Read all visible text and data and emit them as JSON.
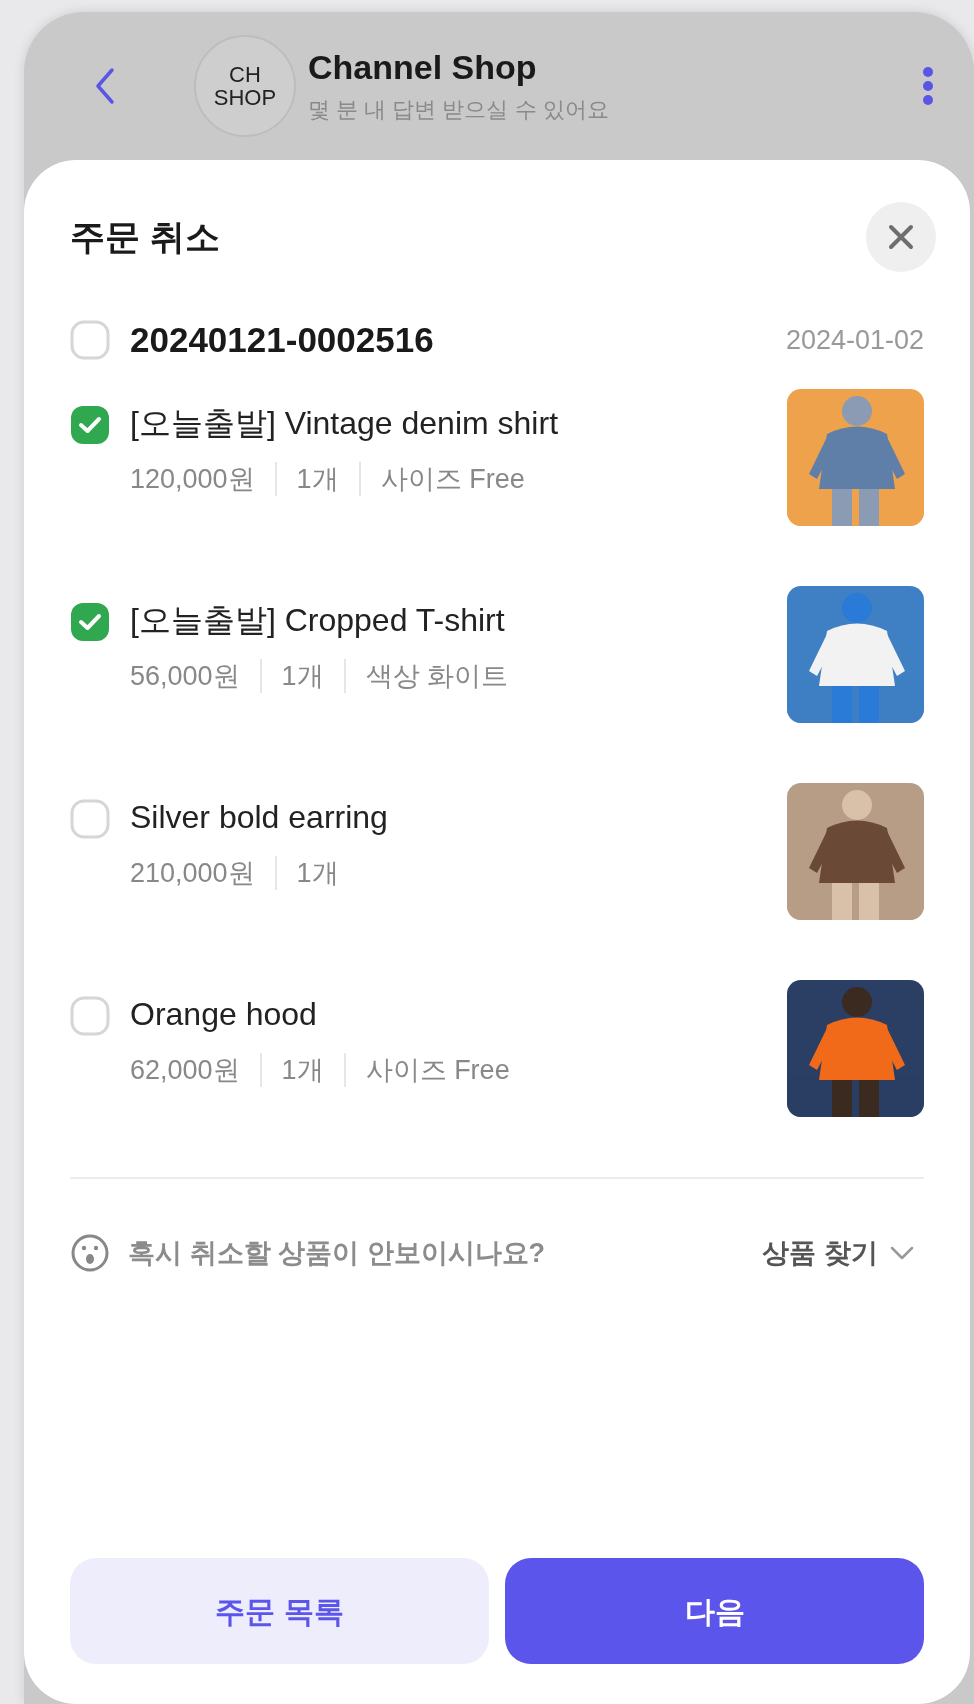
{
  "header": {
    "avatar_lines": [
      "CH",
      "SHOP"
    ],
    "title": "Channel Shop",
    "subtitle": "몇 분 내 답변 받으실 수 있어요"
  },
  "sheet": {
    "title": "주문 취소",
    "order": {
      "number": "20240121-0002516",
      "date": "2024-01-02",
      "checked": false
    },
    "items": [
      {
        "title": "[오늘출발] Vintage denim shirt",
        "details": [
          "120,000원",
          "1개",
          "사이즈 Free"
        ],
        "checked": true,
        "image": {
          "kind": "picture"
        }
      },
      {
        "title": "[오늘출발] Cropped T-shirt",
        "details": [
          "56,000원",
          "1개",
          "색상 화이트"
        ],
        "checked": true,
        "image": {
          "kind": "picture"
        }
      },
      {
        "title": "Silver bold earring",
        "details": [
          "210,000원",
          "1개"
        ],
        "checked": false,
        "image": {
          "kind": "picture"
        }
      },
      {
        "title": "Orange hood",
        "details": [
          "62,000원",
          "1개",
          "사이즈 Free"
        ],
        "checked": false,
        "image": {
          "kind": "picture"
        }
      }
    ],
    "help": {
      "text": "혹시 취소할 상품이 안보이시나요?",
      "link": "상품 찾기"
    },
    "buttons": [
      {
        "label": "주문 목록",
        "kind": "secondary"
      },
      {
        "label": "다음",
        "kind": "primary"
      }
    ]
  }
}
